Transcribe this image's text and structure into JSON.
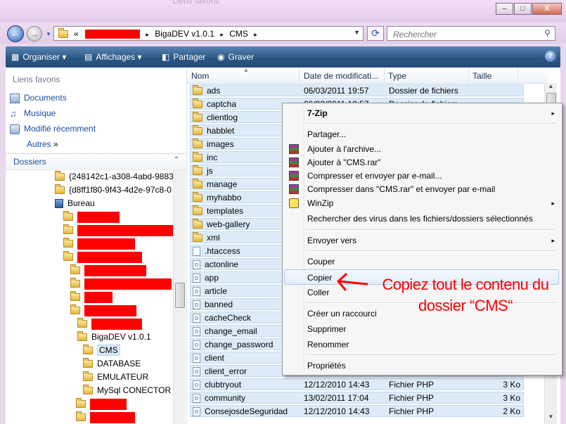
{
  "titlebar": {
    "ghost_text": "Liens favoris",
    "min_glyph": "–",
    "max_glyph": "□",
    "close_glyph": "X"
  },
  "nav_buttons": {
    "back_glyph": "←",
    "forward_glyph": "→"
  },
  "address": {
    "prefix": "«",
    "crumbs": [
      "BigaDEV v1.0.1",
      "CMS"
    ],
    "separator": "▸"
  },
  "search": {
    "placeholder": "Rechercher"
  },
  "toolbar": {
    "organiser": "Organiser",
    "affichages": "Affichages",
    "partager": "Partager",
    "graver": "Graver",
    "help": "?"
  },
  "favorites": {
    "title": "Liens favoris",
    "items": [
      "Documents",
      "Musique",
      "Modifié récemment"
    ],
    "more": "Autres",
    "more_glyph": "»"
  },
  "folders_header": {
    "label": "Dossiers",
    "chevron": "⌃"
  },
  "tree": [
    {
      "label": "{248142c1-a308-4abd-9883-"
    },
    {
      "label": "{d8ff1f80-9f43-4d2e-97c8-0"
    },
    {
      "label": "Bureau"
    },
    {
      "label": "BigaDEV v1.0.1"
    },
    {
      "label": "CMS"
    },
    {
      "label": "DATABASE"
    },
    {
      "label": "EMULATEUR"
    },
    {
      "label": "MySql CONECTOR"
    }
  ],
  "columns": {
    "name": "Nom",
    "date": "Date de modificati...",
    "type": "Type",
    "size": "Taille"
  },
  "files": [
    {
      "name": "ads",
      "date": "06/03/2011 19:57",
      "type": "Dossier de fichiers",
      "size": ""
    },
    {
      "name": "captcha",
      "date": "06/03/2011 19:57",
      "type": "Dossier de fichiers",
      "size": ""
    },
    {
      "name": "clientlog",
      "date": "",
      "type": "",
      "size": ""
    },
    {
      "name": "habblet",
      "date": "",
      "type": "",
      "size": ""
    },
    {
      "name": "images",
      "date": "",
      "type": "",
      "size": ""
    },
    {
      "name": "inc",
      "date": "",
      "type": "",
      "size": ""
    },
    {
      "name": "js",
      "date": "",
      "type": "",
      "size": ""
    },
    {
      "name": "manage",
      "date": "",
      "type": "",
      "size": ""
    },
    {
      "name": "myhabbo",
      "date": "",
      "type": "",
      "size": ""
    },
    {
      "name": "templates",
      "date": "",
      "type": "",
      "size": ""
    },
    {
      "name": "web-gallery",
      "date": "",
      "type": "",
      "size": ""
    },
    {
      "name": "xml",
      "date": "",
      "type": "",
      "size": ""
    },
    {
      "name": ".htaccess",
      "date": "",
      "type": "",
      "size": ""
    },
    {
      "name": "actonline",
      "date": "",
      "type": "",
      "size": ""
    },
    {
      "name": "app",
      "date": "",
      "type": "",
      "size": ""
    },
    {
      "name": "article",
      "date": "",
      "type": "",
      "size": ""
    },
    {
      "name": "banned",
      "date": "",
      "type": "",
      "size": ""
    },
    {
      "name": "cacheCheck",
      "date": "",
      "type": "",
      "size": ""
    },
    {
      "name": "change_email",
      "date": "",
      "type": "",
      "size": ""
    },
    {
      "name": "change_password",
      "date": "",
      "type": "",
      "size": ""
    },
    {
      "name": "client",
      "date": "",
      "type": "",
      "size": ""
    },
    {
      "name": "client_error",
      "date": "",
      "type": "",
      "size": ""
    },
    {
      "name": "clubtryout",
      "date": "12/12/2010 14:43",
      "type": "Fichier PHP",
      "size": "3 Ko"
    },
    {
      "name": "community",
      "date": "13/02/2011 17:04",
      "type": "Fichier PHP",
      "size": "3 Ko"
    },
    {
      "name": "ConsejosdeSeguridad",
      "date": "12/12/2010 14:43",
      "type": "Fichier PHP",
      "size": "2 Ko"
    }
  ],
  "context_menu": {
    "items": [
      {
        "label": "7-Zip",
        "submenu": "▸"
      },
      {
        "label": "Partager..."
      },
      {
        "label": "Ajouter à l'archive..."
      },
      {
        "label": "Ajouter à \"CMS.rar\""
      },
      {
        "label": "Compresser et envoyer par e-mail..."
      },
      {
        "label": "Compresser dans \"CMS.rar\" et envoyer par e-mail"
      },
      {
        "label": "WinZip",
        "submenu": "▸"
      },
      {
        "label": "Rechercher des virus dans les fichiers/dossiers sélectionnés"
      },
      {
        "label": "Envoyer vers",
        "submenu": "▸"
      },
      {
        "label": "Couper"
      },
      {
        "label": "Copier"
      },
      {
        "label": "Coller"
      },
      {
        "label": "Créer un raccourci"
      },
      {
        "label": "Supprimer"
      },
      {
        "label": "Renommer"
      },
      {
        "label": "Propriétés"
      }
    ]
  },
  "annotation": {
    "line1": "Copiez tout le contenu du",
    "line2": "dossier “CMS“"
  },
  "colors": {
    "redaction": "#ff0000",
    "toolbar": "#2b5684",
    "annotation": "#ff0000",
    "menu_highlight": "#e3eefa"
  },
  "icons": {
    "back": "back-arrow-icon",
    "forward": "forward-arrow-icon",
    "refresh": "refresh-icon",
    "search": "search-icon",
    "folder": "folder-icon",
    "php": "php-file-icon",
    "rar": "winrar-icon",
    "winzip": "winzip-icon",
    "help": "help-icon"
  }
}
